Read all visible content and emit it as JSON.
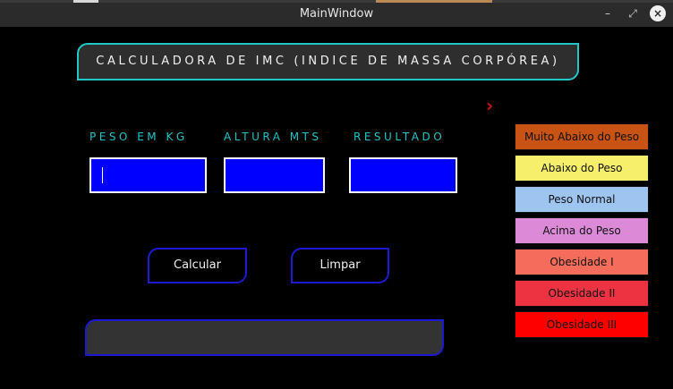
{
  "window": {
    "title": "MainWindow",
    "minimize_glyph": "–",
    "maximize_glyph": "⤢",
    "close_glyph": "×"
  },
  "header": {
    "title": "CALCULADORA DE IMC (INDICE DE MASSA CORPÓREA)"
  },
  "form": {
    "peso_label": "PESO EM KG",
    "altura_label": "ALTURA MTS",
    "resultado_label": "RESULTADO",
    "peso_value": "",
    "altura_value": "",
    "resultado_value": ""
  },
  "buttons": {
    "calcular": "Calcular",
    "limpar": "Limpar"
  },
  "chevron_glyph": "›",
  "legend": [
    {
      "label": "Muito Abaixo do Peso",
      "color": "#c85315"
    },
    {
      "label": "Abaixo do Peso",
      "color": "#f5ef6b"
    },
    {
      "label": "Peso Normal",
      "color": "#9ec5f0"
    },
    {
      "label": "Acima do Peso",
      "color": "#dc8ad8"
    },
    {
      "label": "Obesidade I",
      "color": "#f56c5a"
    },
    {
      "label": "Obesidade II",
      "color": "#ed3341"
    },
    {
      "label": "Obesidade III",
      "color": "#ff0000"
    }
  ],
  "colors": {
    "accent_cyan": "#1fc4c8",
    "input_blue": "#0000ff",
    "border_blue": "#1a1ad0",
    "chevron_red": "#d01010"
  }
}
